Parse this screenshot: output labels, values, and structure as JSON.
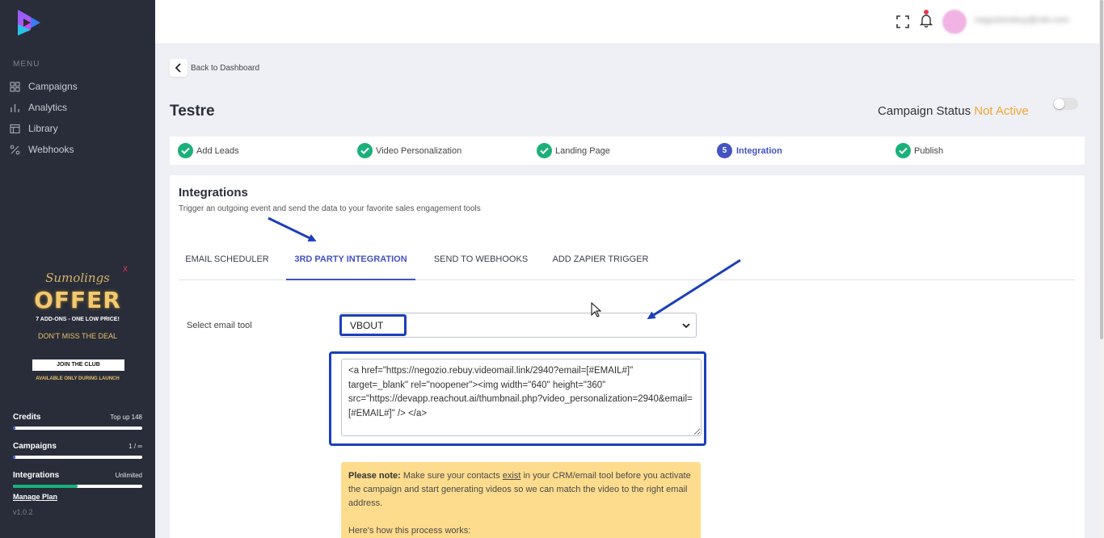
{
  "sidebar": {
    "menu_label": "MENU",
    "items": [
      {
        "label": "Campaigns",
        "icon": "grid-icon"
      },
      {
        "label": "Analytics",
        "icon": "bar-chart-icon"
      },
      {
        "label": "Library",
        "icon": "library-icon"
      },
      {
        "label": "Webhooks",
        "icon": "webhook-icon"
      }
    ],
    "promo": {
      "close": "x",
      "script": "Sumolings",
      "title": "OFFER",
      "subtitle": "7 ADD-ONS - ONE LOW PRICE!",
      "tagline": "DON'T MISS THE DEAL",
      "cta": "JOIN THE CLUB",
      "footer": "AVAILABLE ONLY DURING LAUNCH"
    },
    "usage": {
      "credits": {
        "label": "Credits",
        "right": "Top up  148",
        "progress": 0.02,
        "color": "#4253c2"
      },
      "campaigns": {
        "label": "Campaigns",
        "right": "1 / ∞",
        "progress": 0.01,
        "color": "#4253c2"
      },
      "integrations": {
        "label": "Integrations",
        "right": "Unlimited",
        "progress": 0.5,
        "color": "#1bb07a"
      }
    },
    "manage_plan": "Manage Plan",
    "version": "v1.0.2"
  },
  "topbar": {
    "username": "negoziorebuy@reb.com"
  },
  "page": {
    "back_label": "Back to Dashboard",
    "title": "Testre",
    "status_label": "Campaign Status",
    "status_value": "Not Active",
    "status_color": "#f3a534"
  },
  "steps": [
    {
      "label": "Add Leads",
      "state": "done"
    },
    {
      "label": "Video Personalization",
      "state": "done"
    },
    {
      "label": "Landing Page",
      "state": "done"
    },
    {
      "label": "Integration",
      "state": "active",
      "number": "5"
    },
    {
      "label": "Publish",
      "state": "done"
    }
  ],
  "integrations": {
    "title": "Integrations",
    "subtitle": "Trigger an outgoing event and send the data to your favorite sales engagement tools",
    "tabs": [
      {
        "label": "EMAIL SCHEDULER"
      },
      {
        "label": "3RD PARTY INTEGRATION"
      },
      {
        "label": "SEND TO WEBHOOKS"
      },
      {
        "label": "ADD ZAPIER TRIGGER"
      }
    ],
    "active_tab": 1,
    "select_label": "Select email tool",
    "select_value": "VBOUT",
    "code": "<a href=\"https://negozio.rebuy.videomail.link/2940?email=[#EMAIL#]\" target=_blank\" rel=\"noopener\"><img width=\"640\" height=\"360\" src=\"https://devapp.reachout.ai/thumbnail.php?video_personalization=2940&email=[#EMAIL#]\" /> </a>",
    "note": {
      "bold": "Please note:",
      "text1": " Make sure your contacts ",
      "link": "exist",
      "text2": " in your CRM/email tool before you activate the campaign and start generating videos so we can match the video to the right email address.",
      "line2": "Here's how this process works:"
    }
  },
  "colors": {
    "sidebar": "#282d39",
    "accent": "#4253c2",
    "success": "#1bb07a",
    "highlight": "#1b3fb8",
    "note_bg": "#fedc8d"
  }
}
